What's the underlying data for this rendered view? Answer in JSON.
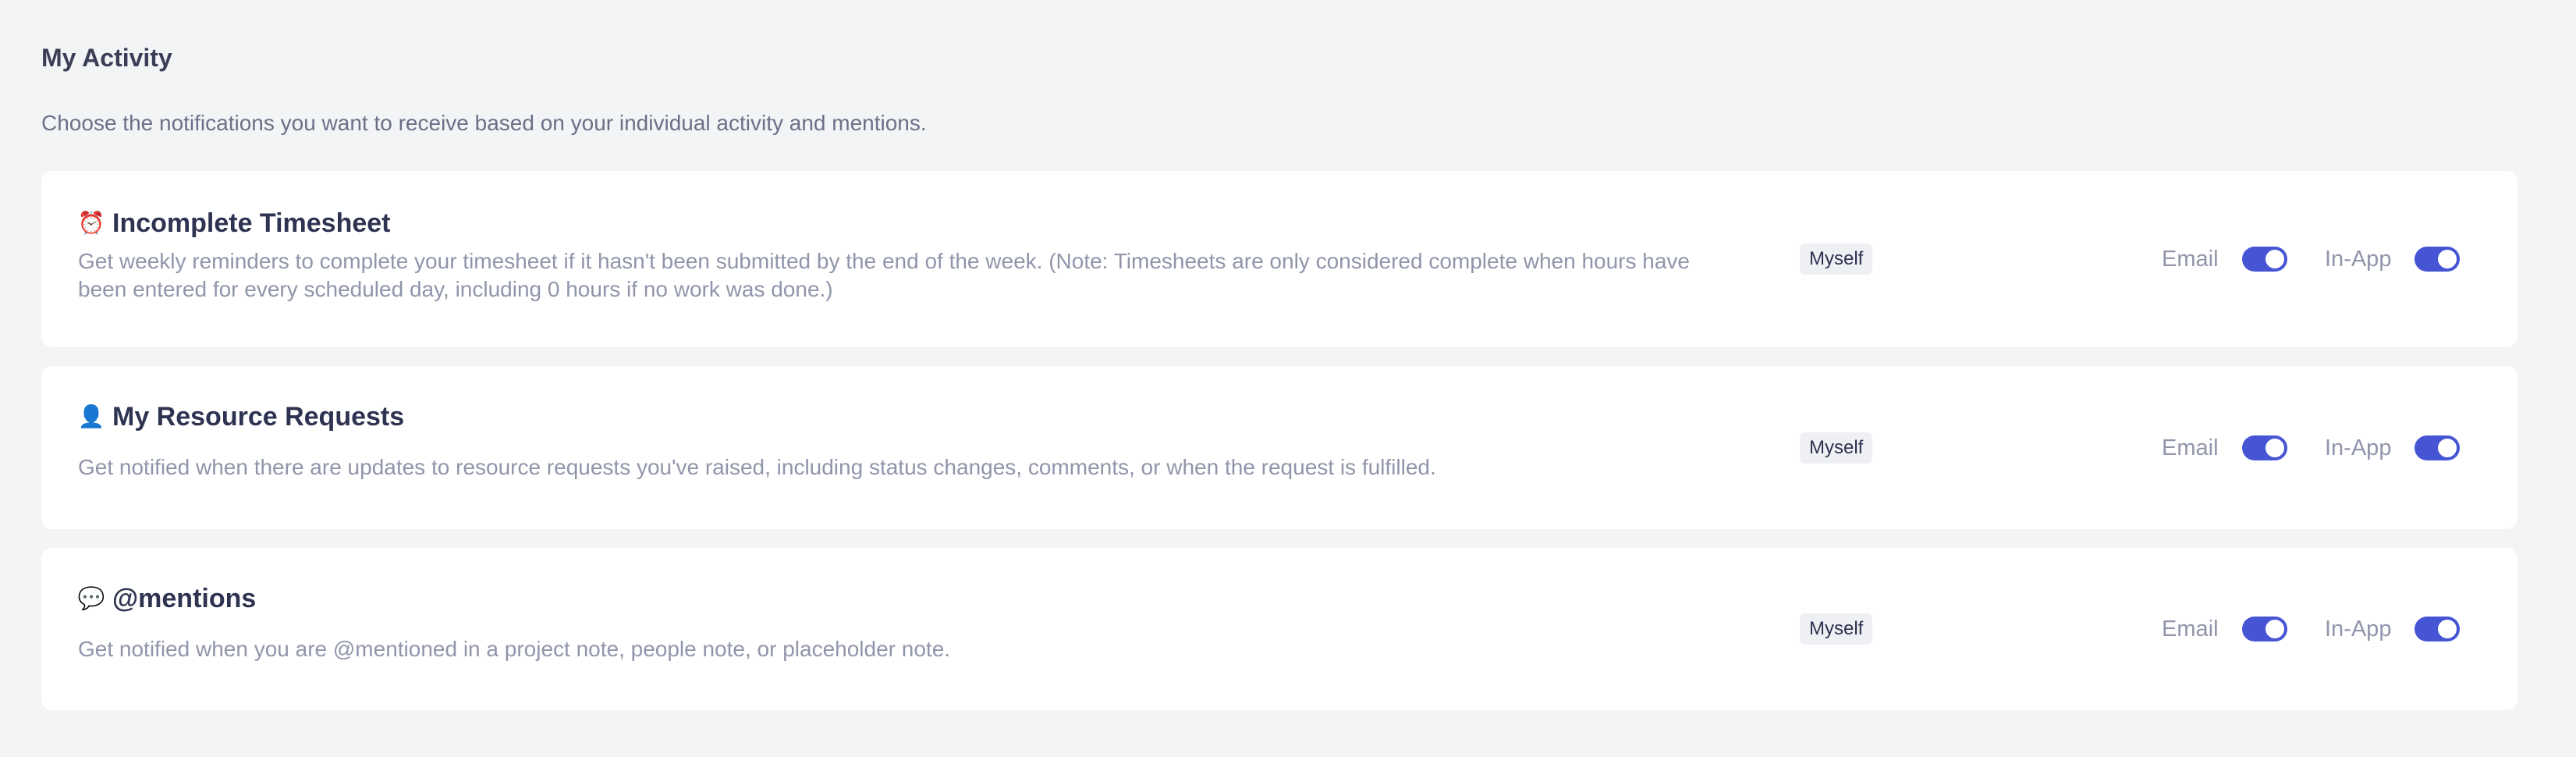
{
  "section": {
    "title": "My Activity",
    "description": "Choose the notifications you want to receive based on your individual activity and mentions."
  },
  "accent_color": "#4655d4",
  "notifications": [
    {
      "icon": "alarm-clock-icon",
      "icon_glyph": "⏰",
      "title": "Incomplete Timesheet",
      "description": "Get weekly reminders to complete your timesheet if it hasn't been submitted by the end of the week. (Note: Timesheets are only considered complete when hours have been entered for every scheduled day, including 0 hours if no work was done.)",
      "recipient": "Myself",
      "email_label": "Email",
      "email_enabled": true,
      "inapp_label": "In-App",
      "inapp_enabled": true
    },
    {
      "icon": "person-icon",
      "icon_glyph": "👤",
      "title": "My Resource Requests",
      "description": "Get notified when there are updates to resource requests you've raised, including status changes, comments, or when the request is fulfilled.",
      "recipient": "Myself",
      "email_label": "Email",
      "email_enabled": true,
      "inapp_label": "In-App",
      "inapp_enabled": true
    },
    {
      "icon": "speech-bubble-icon",
      "icon_glyph": "💬",
      "title": "@mentions",
      "description": "Get notified when you are @mentioned in a project note, people note, or placeholder note.",
      "recipient": "Myself",
      "email_label": "Email",
      "email_enabled": true,
      "inapp_label": "In-App",
      "inapp_enabled": true
    }
  ]
}
